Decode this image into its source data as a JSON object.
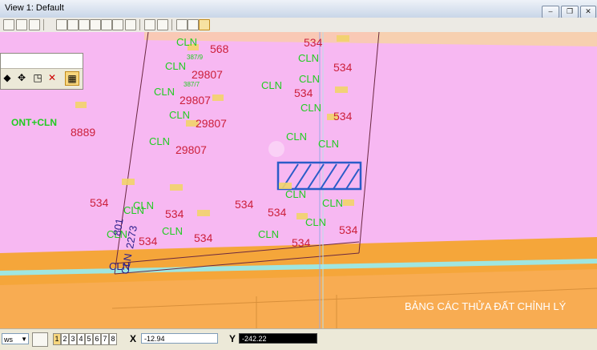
{
  "window": {
    "title": "View 1: Default",
    "buttons": {
      "minimize": "–",
      "restore": "❐",
      "close": "✕"
    }
  },
  "map": {
    "background_color": "#f7b8f2",
    "road_color": "#f5a63a",
    "water_color": "#9fe6e0",
    "land_label_color": "#22cc22",
    "parcel_number_color": "#cc1f3a",
    "highlight_color": "#2a5cc8",
    "labels": [
      {
        "text": "CLN",
        "role": "land-use"
      },
      {
        "text": "568",
        "role": "parcel"
      },
      {
        "text": "534",
        "role": "parcel"
      },
      {
        "text": "CLN",
        "role": "land-use"
      },
      {
        "text": "387/9",
        "role": "small"
      },
      {
        "text": "29807",
        "role": "parcel"
      },
      {
        "text": "CLN",
        "role": "land-use"
      },
      {
        "text": "534",
        "role": "parcel"
      },
      {
        "text": "CLN",
        "role": "land-use"
      },
      {
        "text": "CLN",
        "role": "land-use"
      },
      {
        "text": "387/7",
        "role": "small"
      },
      {
        "text": "29807",
        "role": "parcel"
      },
      {
        "text": "CLN",
        "role": "land-use"
      },
      {
        "text": "534",
        "role": "parcel"
      },
      {
        "text": "CLN",
        "role": "land-use"
      },
      {
        "text": "ONT+CLN",
        "role": "land-use"
      },
      {
        "text": "8889",
        "role": "parcel"
      },
      {
        "text": "CLN",
        "role": "land-use"
      },
      {
        "text": "29807",
        "role": "parcel"
      },
      {
        "text": "534",
        "role": "parcel"
      },
      {
        "text": "CLN",
        "role": "land-use"
      },
      {
        "text": "CLN",
        "role": "land-use"
      },
      {
        "text": "29807",
        "role": "parcel"
      },
      {
        "text": "CLN",
        "role": "land-use"
      },
      {
        "text": "534",
        "role": "parcel"
      },
      {
        "text": "CLN",
        "role": "land-use"
      },
      {
        "text": "CLN",
        "role": "land-use"
      },
      {
        "text": "534",
        "role": "parcel"
      },
      {
        "text": "534",
        "role": "parcel"
      },
      {
        "text": "CLN",
        "role": "land-use"
      },
      {
        "text": "534",
        "role": "parcel"
      },
      {
        "text": "CLN",
        "role": "land-use"
      },
      {
        "text": "CLN",
        "role": "land-use"
      },
      {
        "text": "534",
        "role": "parcel"
      },
      {
        "text": "CLN",
        "role": "land-use"
      },
      {
        "text": "534",
        "role": "parcel"
      },
      {
        "text": "CLN",
        "role": "land-use"
      },
      {
        "text": "534",
        "role": "parcel"
      },
      {
        "text": "CLN",
        "role": "land-use"
      },
      {
        "text": "534",
        "role": "parcel"
      },
      {
        "text": "CLN",
        "role": "line"
      },
      {
        "text": "CLN",
        "role": "line"
      },
      {
        "text": "2273",
        "role": "line"
      },
      {
        "text": "801",
        "role": "line"
      }
    ],
    "footer_text": "BẢNG CÁC THỬA ĐẤT CHỈNH LÝ"
  },
  "statusbar": {
    "view_select": "ws",
    "view_numbers": [
      "1",
      "2",
      "3",
      "4",
      "5",
      "6",
      "7",
      "8"
    ],
    "active_view": "1",
    "x_label": "X",
    "x_value": "-12.94",
    "y_label": "Y",
    "y_value": "-242.22"
  },
  "icons": [
    "fit-view-icon",
    "zoom-in-icon",
    "zoom-out-icon",
    "pan-icon",
    "rotate-icon",
    "fence-icon",
    "select-icon"
  ]
}
